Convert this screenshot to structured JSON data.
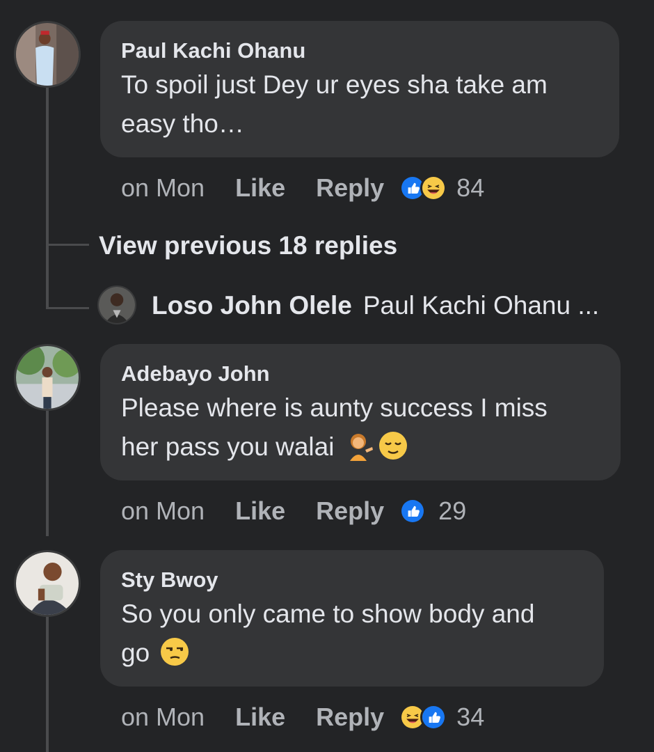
{
  "comments": [
    {
      "author": "Paul Kachi Ohanu",
      "text_line1": "To spoil just Dey ur eyes sha take am",
      "text_line2": "easy tho…",
      "time": "on Mon",
      "like_label": "Like",
      "reply_label": "Reply",
      "reactions": [
        "like-reaction-icon",
        "haha-reaction-icon"
      ],
      "reaction_count": "84"
    },
    {
      "author": "Adebayo John",
      "text_line1": "Please where is aunty success I miss",
      "text_line2": "her pass you walai",
      "inline_emojis": [
        "woman-tipping-hand-emoji",
        "relieved-face-emoji"
      ],
      "time": "on Mon",
      "like_label": "Like",
      "reply_label": "Reply",
      "reactions": [
        "like-reaction-icon"
      ],
      "reaction_count": "29"
    },
    {
      "author": "Sty Bwoy",
      "text_line1": "So you only came to show body and",
      "text_line2": "go",
      "inline_emojis": [
        "unamused-face-emoji"
      ],
      "time": "on Mon",
      "like_label": "Like",
      "reply_label": "Reply",
      "reactions": [
        "haha-reaction-icon",
        "like-reaction-icon"
      ],
      "reaction_count": "34"
    }
  ],
  "thread": {
    "view_previous": "View previous 18 replies",
    "reply_author": "Loso John Olele",
    "reply_snippet": "Paul Kachi Ohanu ..."
  },
  "colors": {
    "background": "#232426",
    "bubble": "#343537",
    "text_primary": "#e4e6eb",
    "text_secondary": "#b0b3b8",
    "like_blue": "#1877f2",
    "haha_yellow": "#f7c948"
  }
}
